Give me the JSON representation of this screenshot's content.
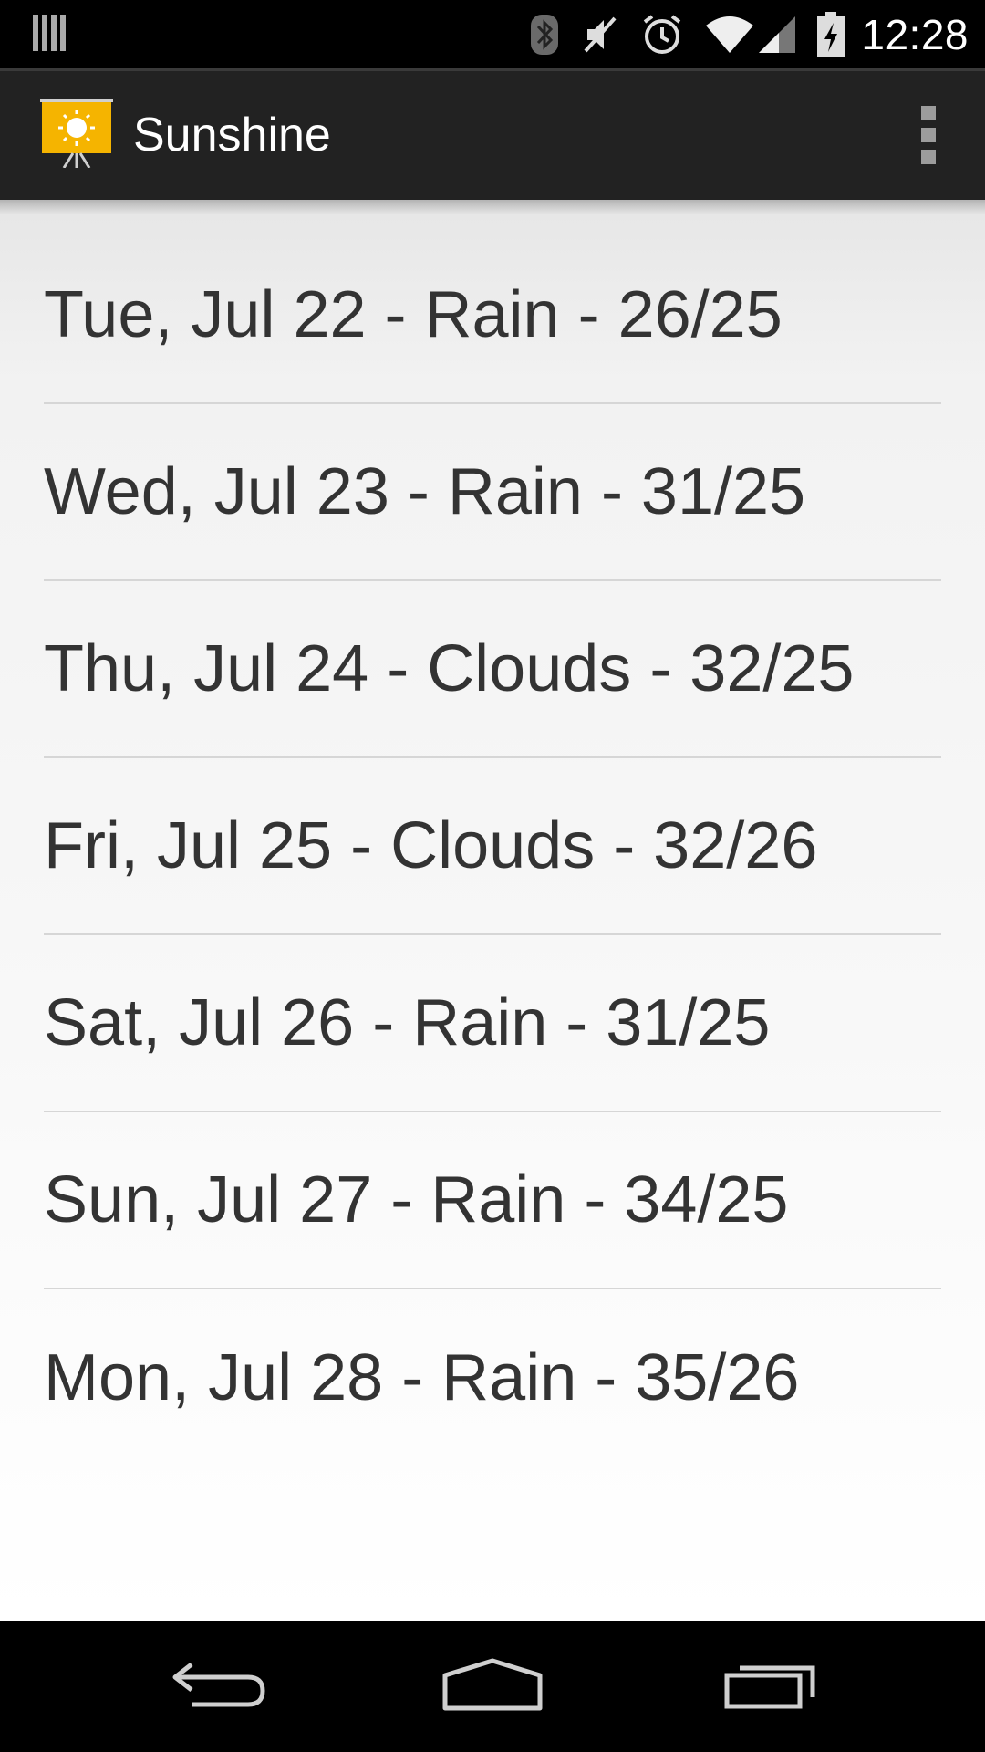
{
  "status_bar": {
    "time": "12:28",
    "icons": [
      "signal-bars-icon",
      "bluetooth-icon",
      "mute-icon",
      "alarm-icon",
      "wifi-icon",
      "cell-signal-icon",
      "battery-charging-icon"
    ]
  },
  "action_bar": {
    "title": "Sunshine",
    "app_icon": "sun-icon",
    "overflow_icon": "overflow-menu-icon"
  },
  "forecast": [
    {
      "text": "Tue, Jul 22 - Rain - 26/25"
    },
    {
      "text": "Wed, Jul 23 - Rain - 31/25"
    },
    {
      "text": "Thu, Jul 24 - Clouds - 32/25"
    },
    {
      "text": "Fri, Jul 25 - Clouds - 32/26"
    },
    {
      "text": "Sat, Jul 26 - Rain - 31/25"
    },
    {
      "text": "Sun, Jul 27 - Rain - 34/25"
    },
    {
      "text": "Mon, Jul 28 - Rain - 35/26"
    }
  ],
  "nav_bar": {
    "icons": [
      "back-icon",
      "home-icon",
      "recents-icon"
    ]
  },
  "colors": {
    "action_bar": "#222222",
    "text": "#333333",
    "divider": "#d6d6d6",
    "icon_yellow": "#f5b400"
  }
}
